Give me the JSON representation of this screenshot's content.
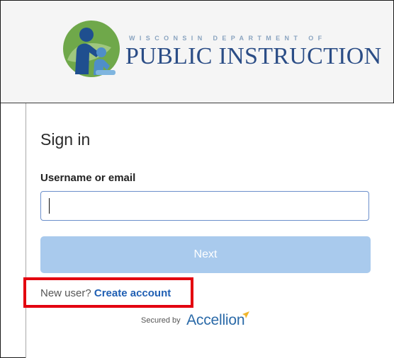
{
  "header": {
    "logo_subtitle": "WISCONSIN DEPARTMENT OF",
    "logo_title": "PUBLIC INSTRUCTION",
    "logo_icon": "family-figures-logo"
  },
  "signin": {
    "title": "Sign in",
    "username_label": "Username or email",
    "username_value": "",
    "next_label": "Next",
    "new_user_text": "New user?",
    "create_account_label": "Create account",
    "secured_by_text": "Secured by",
    "accellion_text": "Accellion"
  },
  "colors": {
    "header_bg": "#f5f5f5",
    "logo_blue": "#2b4d86",
    "logo_light": "#8aa4c0",
    "next_button_bg": "#a9caed",
    "link_blue": "#1f5fb3",
    "highlight_red": "#e3000f",
    "accellion_blue": "#2b6aa8",
    "accellion_gold": "#f0b429"
  }
}
